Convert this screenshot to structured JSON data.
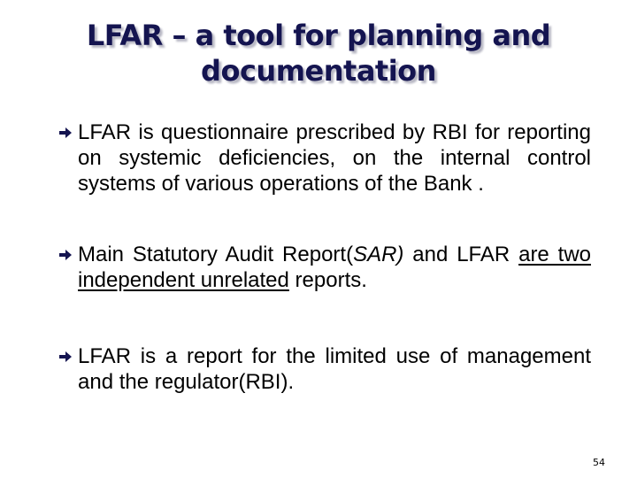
{
  "slide": {
    "title_line1": "LFAR – a tool for planning and",
    "title_line2": "documentation",
    "bullet_icon": "arrow-right-icon",
    "bullet_color": "#141450",
    "title_color": "#141450",
    "bullets": [
      {
        "text": "LFAR is questionnaire prescribed by RBI for reporting on  systemic deficiencies, on the internal control systems of various operations of the Bank ."
      },
      {
        "text_part1": "Main Statutory Audit Report(",
        "text_italic": "SAR)",
        "text_part2": " and LFAR ",
        "text_underlined": "are two  independent unrelated",
        "text_part3": " reports."
      },
      {
        "text": "LFAR is a report for the limited use of management and the regulator(RBI)."
      }
    ],
    "page_number": "54"
  }
}
